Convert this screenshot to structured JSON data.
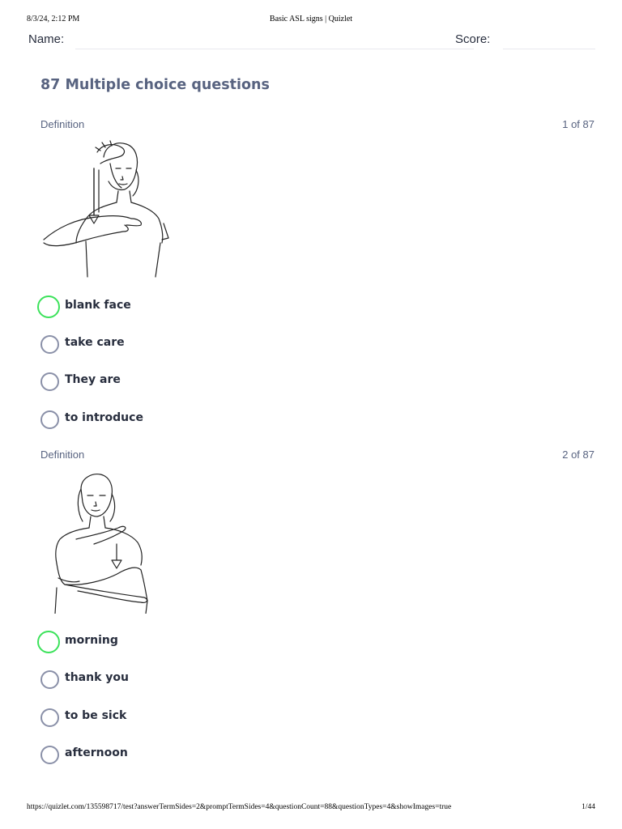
{
  "print_header": {
    "datetime": "8/3/24, 2:12 PM",
    "title": "Basic ASL signs | Quizlet"
  },
  "form": {
    "name_label": "Name:",
    "score_label": "Score:"
  },
  "section": {
    "title": "87 Multiple choice questions"
  },
  "questions": [
    {
      "label": "Definition",
      "counter": "1 of 87",
      "image_icon": "asl-sign-illustration",
      "options": [
        "blank face",
        "take care",
        "They are",
        "to introduce"
      ],
      "highlighted_option": 0
    },
    {
      "label": "Definition",
      "counter": "2 of 87",
      "image_icon": "asl-sign-illustration",
      "options": [
        "morning",
        "thank you",
        "to be sick",
        "afternoon"
      ],
      "highlighted_option": 0
    }
  ],
  "print_footer": {
    "url": "https://quizlet.com/135598717/test?answerTermSides=2&promptTermSides=4&questionCount=88&questionTypes=4&showImages=true",
    "page": "1/44"
  },
  "colors": {
    "title": "#586380",
    "text": "#282e3e",
    "radio": "#8a90a8",
    "highlight": "#3ce25b"
  }
}
